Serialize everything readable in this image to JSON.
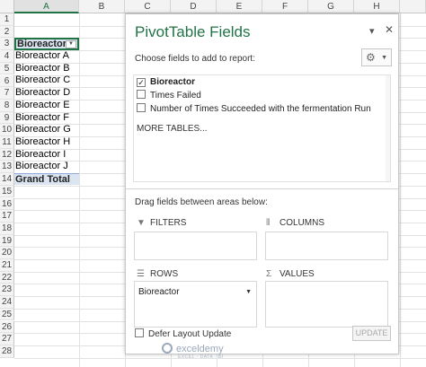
{
  "columns": [
    "A",
    "B",
    "C",
    "D",
    "E",
    "F",
    "G",
    "H"
  ],
  "rows": [
    "1",
    "2",
    "3",
    "4",
    "5",
    "6",
    "7",
    "8",
    "9",
    "10",
    "11",
    "12",
    "13",
    "14",
    "15",
    "16",
    "17",
    "18",
    "19",
    "20",
    "21",
    "22",
    "23",
    "24",
    "25",
    "26",
    "27",
    "28"
  ],
  "pivot_table": {
    "header": "Bioreactor",
    "items": [
      "Bioreactor A",
      "Bioreactor B",
      "Bioreactor C",
      "Bioreactor D",
      "Bioreactor E",
      "Bioreactor F",
      "Bioreactor G",
      "Bioreactor H",
      "Bioreactor I",
      "Bioreactor J"
    ],
    "grand_total": "Grand Total"
  },
  "pane": {
    "title": "PivotTable Fields",
    "choose_label": "Choose fields to add to report:",
    "fields": [
      {
        "label": "Bioreactor",
        "checked": "✓"
      },
      {
        "label": "Times Failed",
        "checked": ""
      },
      {
        "label": "Number of Times Succeeded with the fermentation Run",
        "checked": ""
      }
    ],
    "more_tables": "MORE TABLES...",
    "drag_label": "Drag fields between areas below:",
    "areas": {
      "filters": "FILTERS",
      "columns": "COLUMNS",
      "rows": "ROWS",
      "values": "VALUES"
    },
    "rows_field": "Bioreactor",
    "defer_label": "Defer Layout Update",
    "update_label": "UPDATE"
  },
  "watermark": {
    "name": "exceldemy",
    "tagline": "EXCEL · DATA · BI"
  },
  "colors": {
    "accent": "#217346",
    "pivot_header": "#dbe5f1"
  }
}
